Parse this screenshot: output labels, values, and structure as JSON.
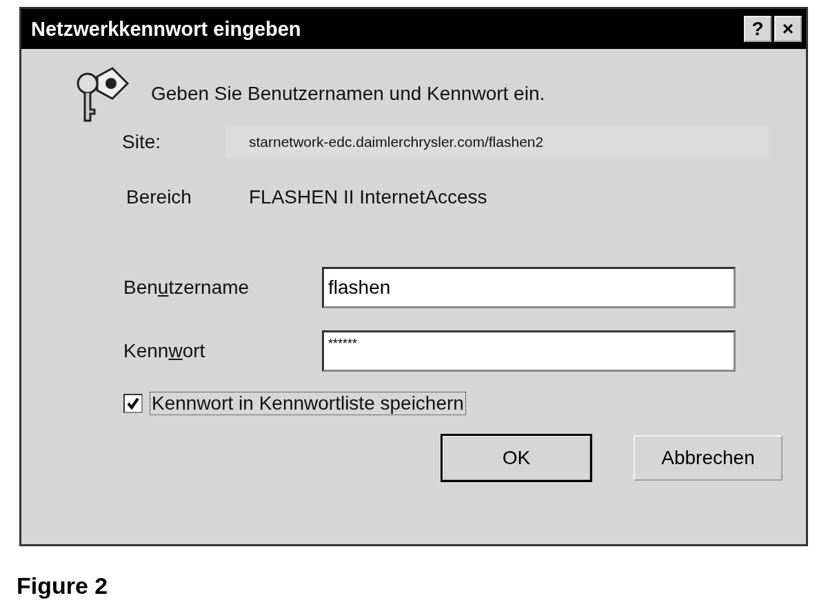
{
  "window": {
    "title": "Netzwerkkennwort eingeben",
    "title_buttons": [
      "?",
      "×"
    ]
  },
  "prompt": "Geben Sie Benutzernamen und Kennwort ein.",
  "info": [
    {
      "label": "Site:",
      "value": "starnetwork-edc.daimlerchrysler.com/flashen2",
      "kind": "box"
    },
    {
      "label": "Bereich",
      "value": "FLASHEN II InternetAccess",
      "kind": "plain"
    }
  ],
  "fields": [
    {
      "label_parts": [
        "Ben",
        "u",
        "tzername"
      ],
      "value": "flashen"
    },
    {
      "label_parts": [
        "Kenn",
        "w",
        "ort"
      ],
      "value": "******"
    }
  ],
  "save_password": {
    "label": "Kennwort in Kennwortliste speichern",
    "checked": true,
    "focused": true
  },
  "buttons": [
    {
      "label": "OK",
      "default": true
    },
    {
      "label": "Abbrechen",
      "default": false
    }
  ],
  "caption": "Figure 2"
}
